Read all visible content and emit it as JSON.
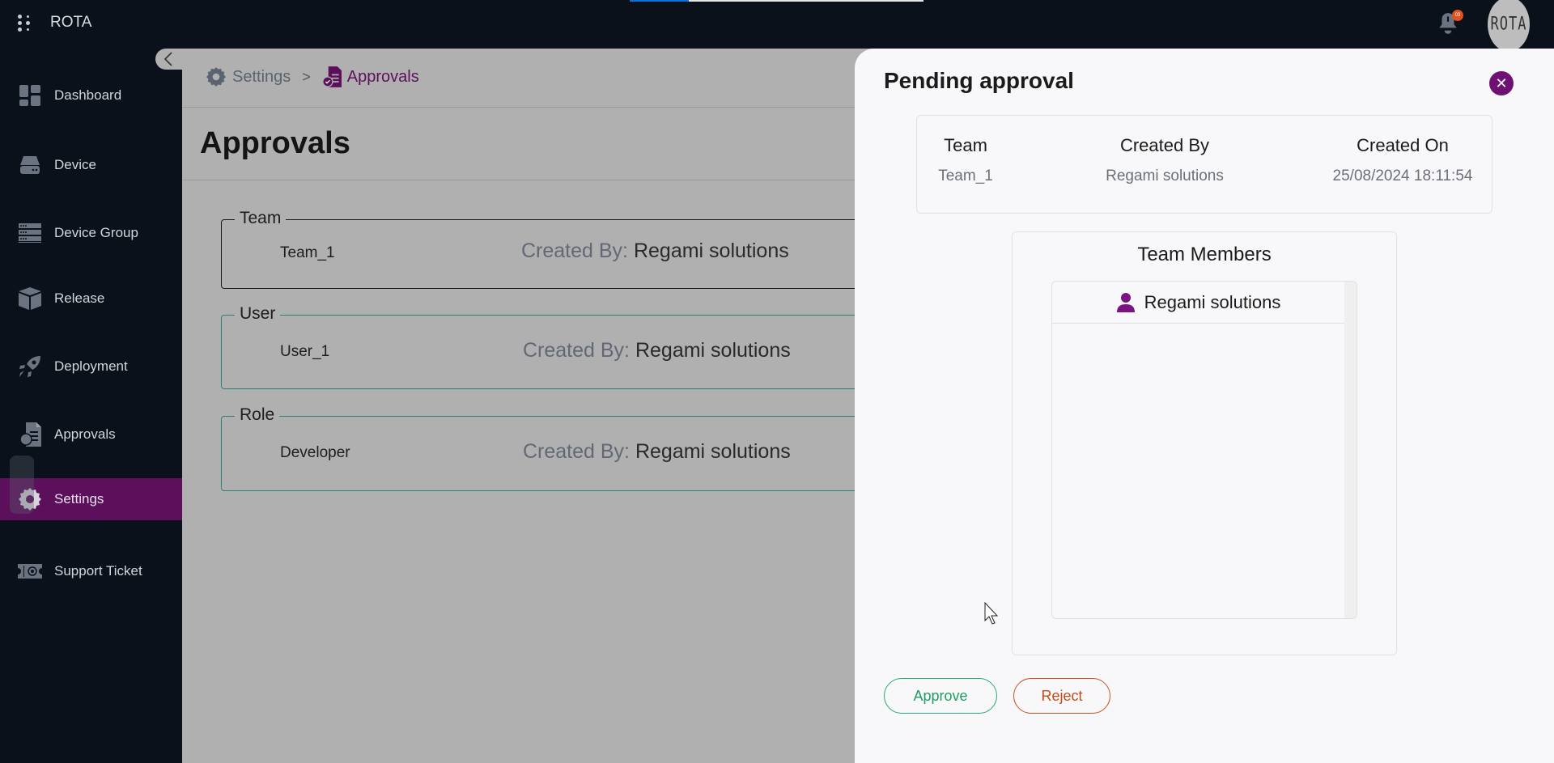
{
  "app": {
    "title": "ROTA",
    "page_load_progress": 0.2,
    "notifications": {
      "count": "03"
    },
    "avatar_text": "ROTA"
  },
  "sidebar": {
    "items": [
      {
        "label": "Dashboard",
        "icon": "dashboard-icon"
      },
      {
        "label": "Device",
        "icon": "hard-drive-icon"
      },
      {
        "label": "Device Group",
        "icon": "server-rack-icon"
      },
      {
        "label": "Release",
        "icon": "cube-icon"
      },
      {
        "label": "Deployment",
        "icon": "rocket-icon"
      },
      {
        "label": "Approvals",
        "icon": "approval-document-icon"
      },
      {
        "label": "Settings",
        "icon": "gear-icon",
        "active": true
      },
      {
        "label": "Support Ticket",
        "icon": "ticket-icon"
      }
    ],
    "collapse_icon": "chevron-left-icon"
  },
  "breadcrumb": {
    "items": [
      {
        "label": "Settings",
        "icon": "gear-icon"
      },
      {
        "label": "Approvals",
        "icon": "approval-document-icon"
      }
    ],
    "separator": ">"
  },
  "main": {
    "title": "Approvals",
    "cards": [
      {
        "legend": "Team",
        "name": "Team_1",
        "created_by_label": "Created By:",
        "created_by": "Regami solutions"
      },
      {
        "legend": "User",
        "name": "User_1",
        "created_by_label": "Created By:",
        "created_by": "Regami solutions"
      },
      {
        "legend": "Role",
        "name": "Developer",
        "created_by_label": "Created By:",
        "created_by": "Regami solutions"
      }
    ]
  },
  "drawer": {
    "title": "Pending approval",
    "info": {
      "headers": [
        "Team",
        "Created By",
        "Created On"
      ],
      "values": [
        "Team_1",
        "Regami solutions",
        "25/08/2024 18:11:54"
      ]
    },
    "members": {
      "title": "Team Members",
      "items": [
        {
          "name": "Regami solutions",
          "icon": "person-icon"
        }
      ]
    },
    "approve_label": "Approve",
    "reject_label": "Reject"
  },
  "colors": {
    "brand": "#5c105c",
    "approve": "#1f9e62",
    "reject": "#c24b16",
    "sidebar_bg": "#0b111b",
    "progress": "#0a72d6"
  }
}
